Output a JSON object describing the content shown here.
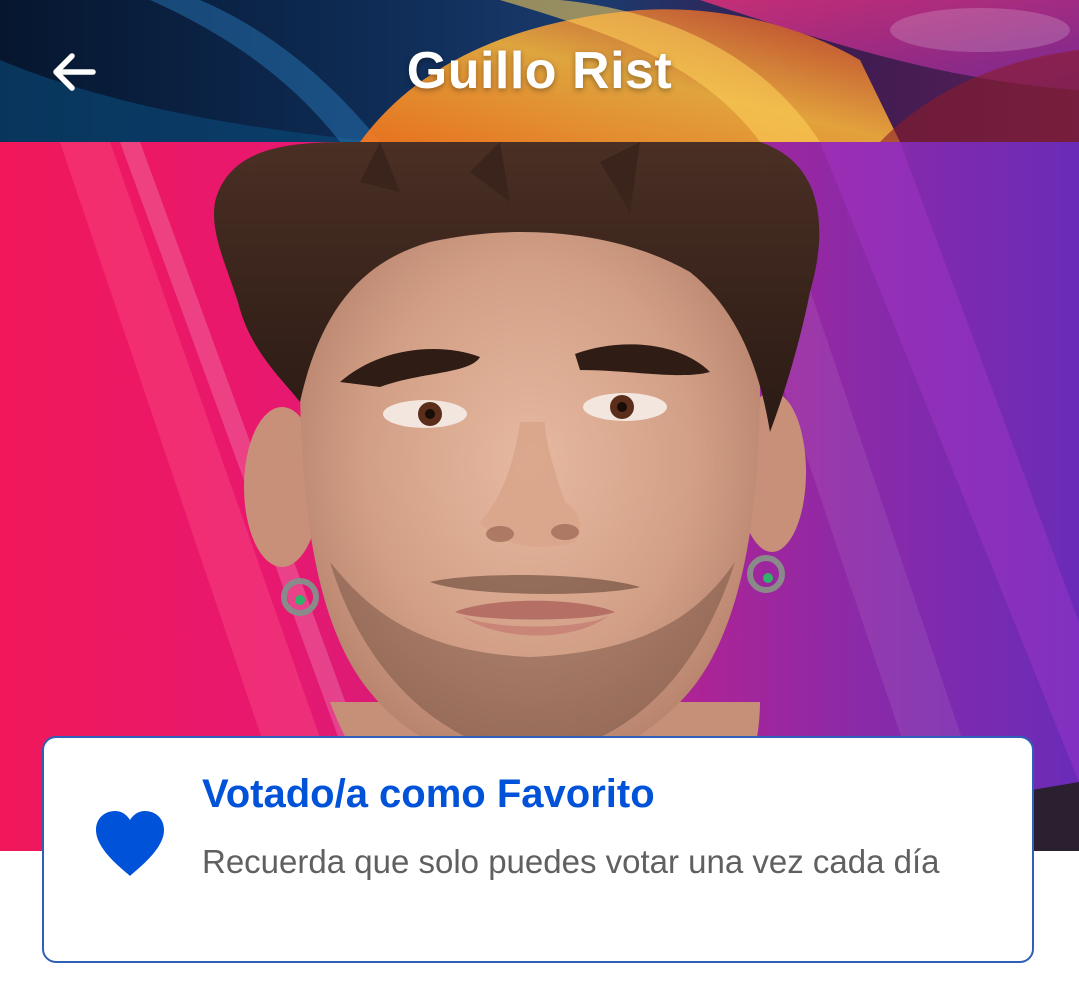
{
  "header": {
    "title": "Guillo Rist",
    "back_icon": "arrow-left-icon"
  },
  "hero": {
    "image": "contestant-portrait"
  },
  "favorite_card": {
    "icon": "heart-icon",
    "title": "Votado/a como Favorito",
    "message": "Recuerda que solo puedes votar una vez cada día"
  },
  "colors": {
    "accent_blue": "#0052d9",
    "card_border": "#2f5fb6",
    "message_gray": "#606060",
    "header_dark": "#0b1f3d"
  }
}
